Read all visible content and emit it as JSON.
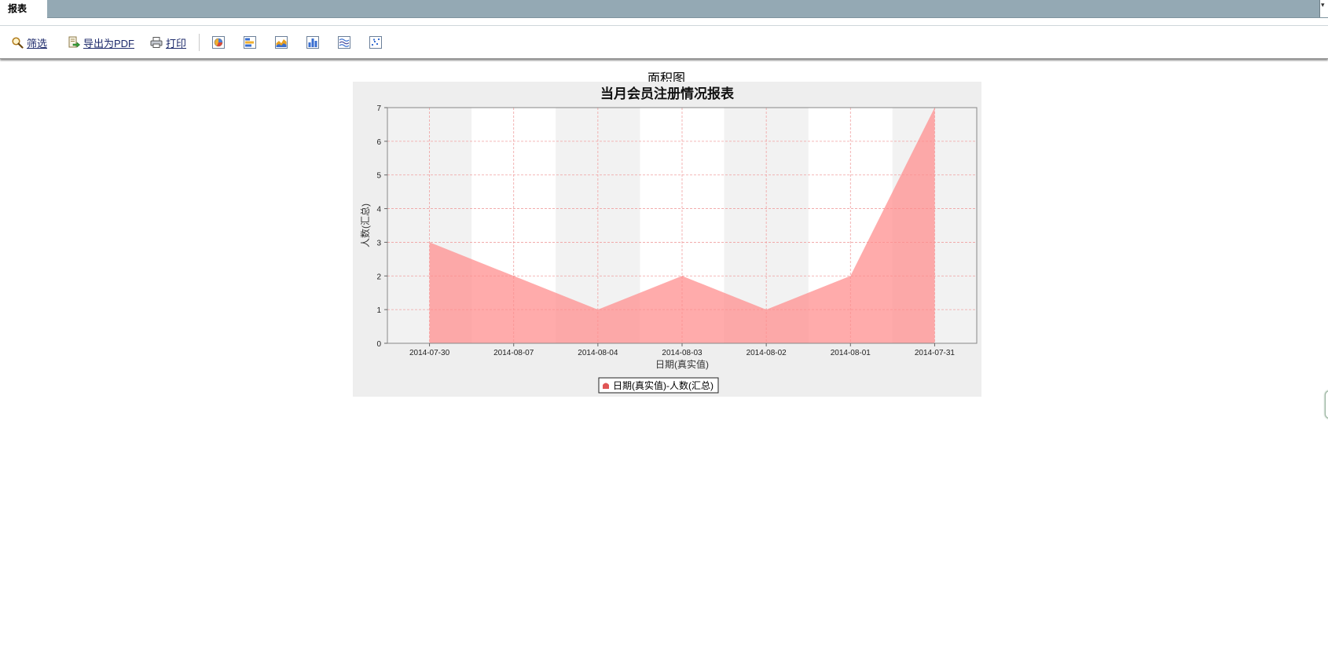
{
  "tabs": [
    {
      "label": "报表"
    }
  ],
  "toolbar": {
    "filter_label": "筛选",
    "export_pdf_label": "导出为PDF",
    "print_label": "打印",
    "chart_type_icons": [
      "pie-chart-icon",
      "horizontal-bar-chart-icon",
      "area-chart-icon",
      "bar-chart-icon",
      "line-chart-icon",
      "scatter-chart-icon"
    ]
  },
  "chart_caption": "面积图",
  "chart_data": {
    "type": "area",
    "title": "当月会员注册情况报表",
    "xlabel": "日期(真实值)",
    "ylabel": "人数(汇总)",
    "categories": [
      "2014-07-30",
      "2014-08-07",
      "2014-08-04",
      "2014-08-03",
      "2014-08-02",
      "2014-08-01",
      "2014-07-31"
    ],
    "series": [
      {
        "name": "日期(真实值)-人数(汇总)",
        "values": [
          3,
          2,
          1,
          2,
          1,
          2,
          7
        ]
      }
    ],
    "ylim": [
      0,
      7
    ],
    "yticks": [
      0,
      1,
      2,
      3,
      4,
      5,
      6,
      7
    ],
    "grid": true,
    "legend": "bottom-center",
    "colors": {
      "series": "#ff8a8a",
      "grid": "#f0a0a0",
      "band": "#f2f2f2",
      "panel": "#eeeeee"
    }
  }
}
